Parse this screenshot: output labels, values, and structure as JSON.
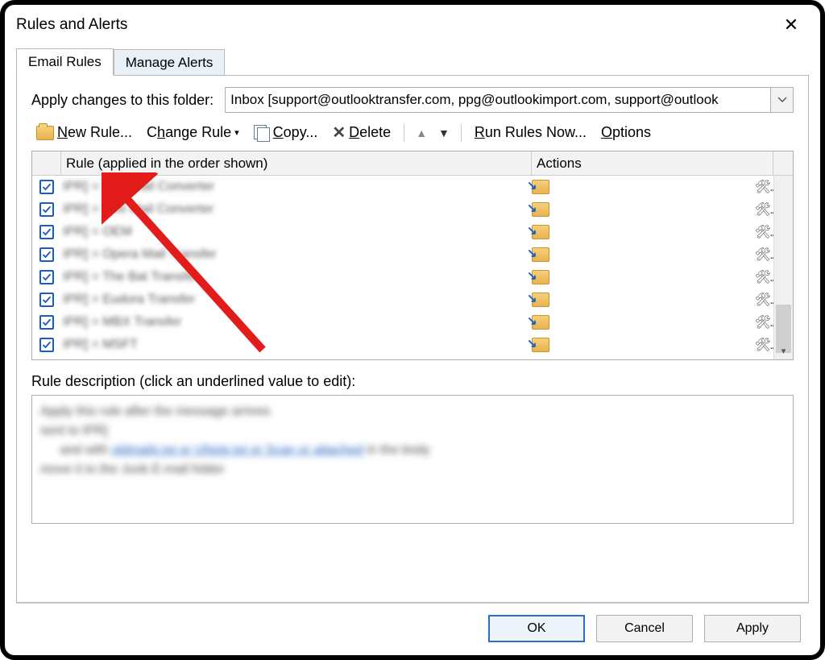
{
  "dialog": {
    "title": "Rules and Alerts",
    "close": "✕"
  },
  "tabs": {
    "email_rules": "Email Rules",
    "manage_alerts": "Manage Alerts"
  },
  "folder": {
    "label": "Apply changes to this folder:",
    "value": "Inbox [support@outlooktransfer.com, ppg@outlookimport.com, support@outlook"
  },
  "toolbar": {
    "new_rule": "New Rule...",
    "change_rule": "Change Rule",
    "copy": "Copy...",
    "delete": "Delete",
    "run_rules": "Run Rules Now...",
    "options": "Options"
  },
  "columns": {
    "rule": "Rule (applied in the order shown)",
    "actions": "Actions"
  },
  "rules": [
    {
      "checked": true,
      "name": "IPR] = Mac Mail Converter"
    },
    {
      "checked": true,
      "name": "IPR] = Live Mail Converter"
    },
    {
      "checked": true,
      "name": "IPR] = OEM"
    },
    {
      "checked": true,
      "name": "IPR] = Opera Mail Transfer"
    },
    {
      "checked": true,
      "name": "IPR] = The Bat Transfer"
    },
    {
      "checked": true,
      "name": "IPR] = Eudora Transfer"
    },
    {
      "checked": true,
      "name": "IPR] = MBX Transfer"
    },
    {
      "checked": true,
      "name": "IPR] = MSFT"
    }
  ],
  "description_label": "Rule description (click an underlined value to edit):",
  "description_lines": [
    "Apply this rule after the message arrives",
    "sent to IPR]",
    "and with oldmails.txt or UNzip.txt or Scan or attached in the body",
    "move it to the Junk E-mail folder"
  ],
  "buttons": {
    "ok": "OK",
    "cancel": "Cancel",
    "apply": "Apply"
  }
}
